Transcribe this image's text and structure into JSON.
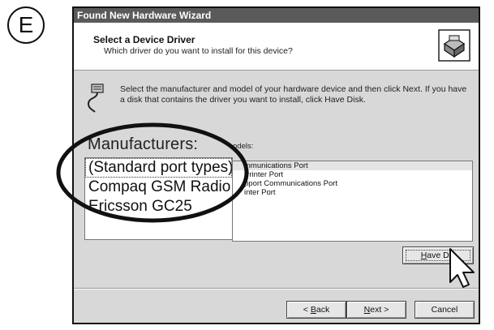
{
  "step_badge": "E",
  "window": {
    "title": "Found New Hardware Wizard",
    "header_title": "Select a Device Driver",
    "header_subtitle": "Which driver do you want to install for this device?",
    "header_icon": "hardware-wizard-icon",
    "instruction": "Select the manufacturer and model of your hardware device and then click Next. If you have a disk that contains the driver you want to install, click Have Disk.",
    "instruction_icon": "connector-icon"
  },
  "manufacturers": {
    "label": "Manufacturers:",
    "items": [
      "(Standard port types)",
      "Compaq GSM Radio C",
      "Ericsson GC25"
    ],
    "selected_index": 0
  },
  "models": {
    "label": "odels:",
    "items": [
      "mmunications Port",
      "Printer Port",
      "pport Communications Port",
      "inter Port"
    ],
    "selected_index": 0
  },
  "buttons": {
    "have_disk": {
      "pre": "",
      "key": "H",
      "rest": "ave Dis"
    },
    "back": {
      "pre": "< ",
      "key": "B",
      "rest": "ack"
    },
    "next": {
      "pre": "",
      "key": "N",
      "rest": "ext >"
    },
    "cancel": "Cancel"
  },
  "colors": {
    "titlebar": "#5a5a5a",
    "window_bg": "#d8d8d8",
    "highlight_ellipse": "#111111"
  }
}
